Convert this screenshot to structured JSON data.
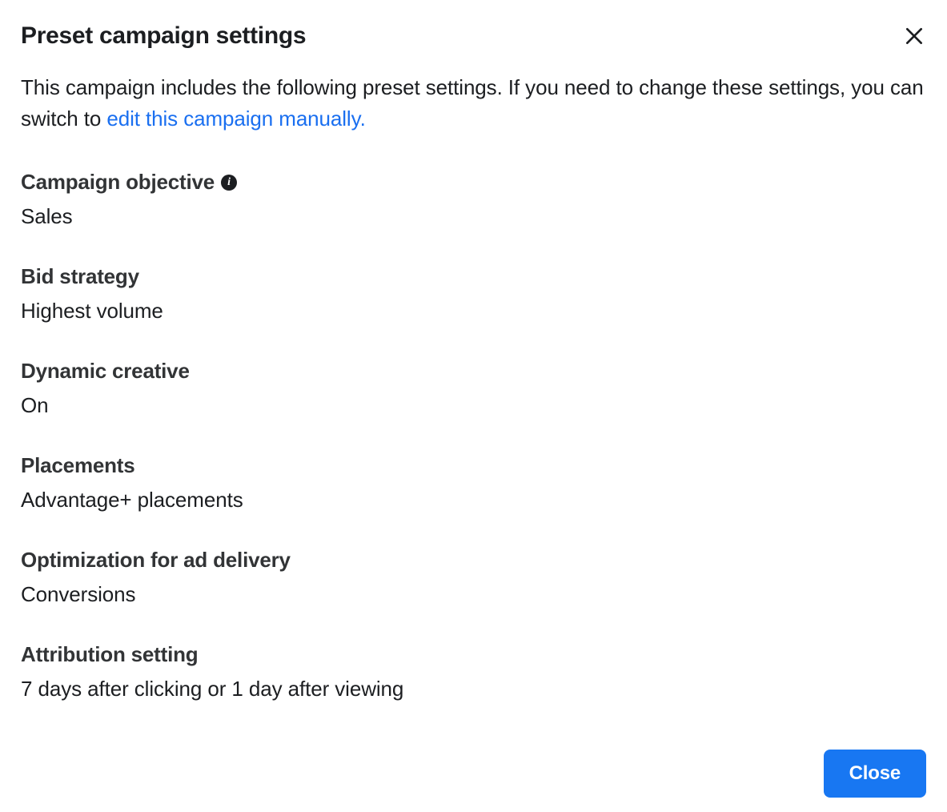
{
  "header": {
    "title": "Preset campaign settings"
  },
  "description": {
    "text_before_link": "This campaign includes the following preset settings. If you need to change these settings, you can switch to ",
    "link_text": "edit this campaign manually."
  },
  "settings": {
    "campaign_objective": {
      "label": "Campaign objective",
      "value": "Sales",
      "has_info": true
    },
    "bid_strategy": {
      "label": "Bid strategy",
      "value": "Highest volume"
    },
    "dynamic_creative": {
      "label": "Dynamic creative",
      "value": "On"
    },
    "placements": {
      "label": "Placements",
      "value": "Advantage+ placements"
    },
    "optimization": {
      "label": "Optimization for ad delivery",
      "value": "Conversions"
    },
    "attribution": {
      "label": "Attribution setting",
      "value": "7 days after clicking or 1 day after viewing"
    }
  },
  "footer": {
    "close_label": "Close"
  },
  "info_glyph": "i"
}
